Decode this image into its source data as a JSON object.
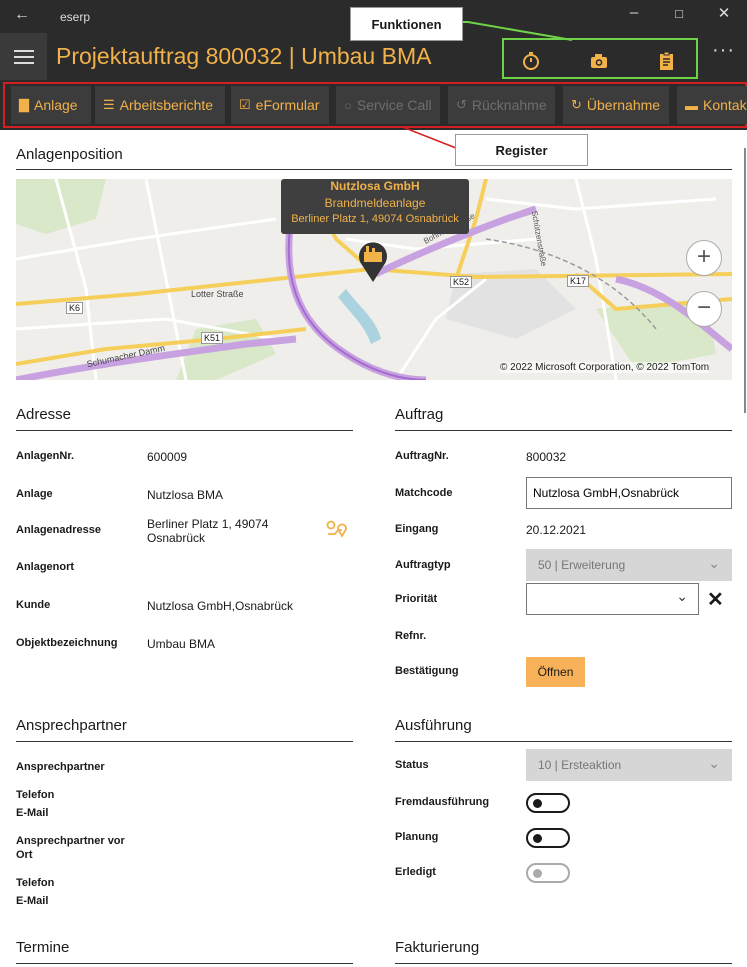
{
  "window": {
    "app_name": "eserp",
    "back_icon": "arrow-left-icon"
  },
  "header": {
    "title": "Projektauftrag 800032  |  Umbau BMA",
    "more_label": "···"
  },
  "callouts": {
    "funktionen": "Funktionen",
    "register": "Register"
  },
  "tabs": [
    {
      "label": "Anlage",
      "icon": "building-icon",
      "enabled": true
    },
    {
      "label": "Arbeitsberichte",
      "icon": "clipboard-icon",
      "enabled": true
    },
    {
      "label": "eFormular",
      "icon": "checklist-icon",
      "enabled": true
    },
    {
      "label": "Service Call",
      "icon": "headset-icon",
      "enabled": false
    },
    {
      "label": "Rücknahme",
      "icon": "undo-icon",
      "enabled": false
    },
    {
      "label": "Übernahme",
      "icon": "refresh-icon",
      "enabled": true
    },
    {
      "label": "Kontakt",
      "icon": "chat-icon",
      "enabled": true
    }
  ],
  "map_section": {
    "title": "Anlagenposition",
    "popup": {
      "name": "Nutzlosa GmbH",
      "type": "Brandmeldeanlage",
      "address": "Berliner Platz 1, 49074 Osnabrück"
    },
    "labels": {
      "k6": "K6",
      "k51": "K51",
      "k52": "K52",
      "k17": "K17",
      "lotter": "Lotter Straße",
      "damm": "Schumacher Damm",
      "schuetzen": "Schützenstraße",
      "bohmter": "Bohmter Straße"
    },
    "zoom_in": "+",
    "zoom_out": "−",
    "copyright": "© 2022 Microsoft Corporation, © 2022 TomTom"
  },
  "adresse": {
    "title": "Adresse",
    "anlagennr_label": "AnlagenNr.",
    "anlagennr": "600009",
    "anlage_label": "Anlage",
    "anlage": "Nutzlosa BMA",
    "adresse_label": "Anlagenadresse",
    "adresse_l1": "Berliner Platz 1, 49074",
    "adresse_l2": "Osnabrück",
    "ort_label": "Anlagenort",
    "kunde_label": "Kunde",
    "kunde": "Nutzlosa GmbH,Osnabrück",
    "objekt_label": "Objektbezeichnung",
    "objekt": "Umbau BMA"
  },
  "auftrag": {
    "title": "Auftrag",
    "nr_label": "AuftragNr.",
    "nr": "800032",
    "matchcode_label": "Matchcode",
    "matchcode": "Nutzlosa GmbH,Osnabrück",
    "eingang_label": "Eingang",
    "eingang": "20.12.2021",
    "typ_label": "Auftragtyp",
    "typ": "50  |  Erweiterung",
    "prio_label": "Priorität",
    "prio": "",
    "refnr_label": "Refnr.",
    "bestaetigung_label": "Bestätigung",
    "open_button": "Öffnen"
  },
  "ansprechpartner": {
    "title": "Ansprechpartner",
    "ap_label": "Ansprechpartner",
    "tel_label": "Telefon",
    "mail_label": "E-Mail",
    "ap_ort_l1": "Ansprechpartner vor",
    "ap_ort_l2": "Ort",
    "tel2_label": "Telefon",
    "mail2_label": "E-Mail"
  },
  "ausfuehrung": {
    "title": "Ausführung",
    "status_label": "Status",
    "status": "10  |  Ersteaktion",
    "fremd_label": "Fremdausführung",
    "fremd": false,
    "planung_label": "Planung",
    "planung": false,
    "erledigt_label": "Erledigt",
    "erledigt": false
  },
  "footer": {
    "termine": "Termine",
    "fakturierung": "Fakturierung"
  }
}
